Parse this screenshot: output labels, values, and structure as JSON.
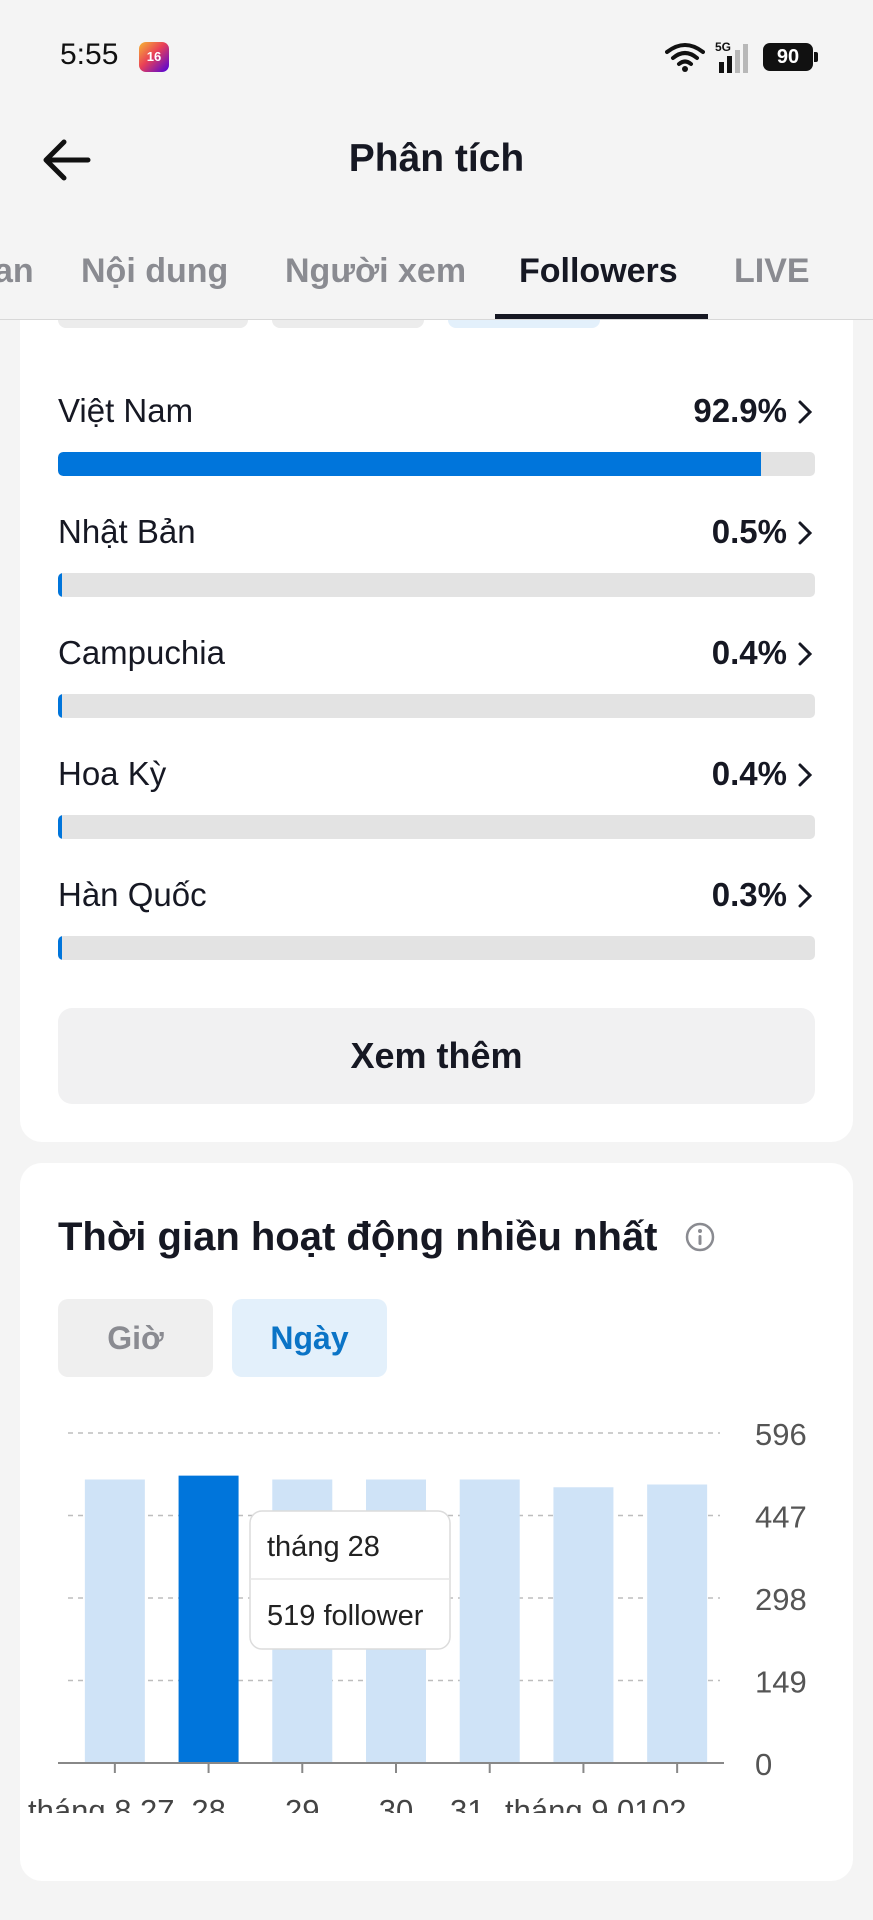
{
  "status_bar": {
    "time": "5:55",
    "app_badge": "16",
    "network": "5G",
    "battery": "90"
  },
  "header": {
    "title": "Phân tích",
    "back_icon": "arrow-left-icon"
  },
  "tabs": [
    {
      "label": "an",
      "active": false
    },
    {
      "label": "Nội dung",
      "active": false
    },
    {
      "label": "Người xem",
      "active": false
    },
    {
      "label": "Followers",
      "active": true
    },
    {
      "label": "LIVE",
      "active": false
    }
  ],
  "countries": [
    {
      "name": "Việt Nam",
      "percent_label": "92.9%",
      "percent": 92.9
    },
    {
      "name": "Nhật Bản",
      "percent_label": "0.5%",
      "percent": 0.5
    },
    {
      "name": "Campuchia",
      "percent_label": "0.4%",
      "percent": 0.4
    },
    {
      "name": "Hoa Kỳ",
      "percent_label": "0.4%",
      "percent": 0.4
    },
    {
      "name": "Hàn Quốc",
      "percent_label": "0.3%",
      "percent": 0.3
    }
  ],
  "see_more_label": "Xem thêm",
  "activity": {
    "title": "Thời gian hoạt động nhiều nhất",
    "toggles": [
      {
        "label": "Giờ",
        "active": false
      },
      {
        "label": "Ngày",
        "active": true
      }
    ],
    "tooltip": {
      "date": "tháng 28",
      "value": "519 follower"
    }
  },
  "colors": {
    "accent": "#0075db",
    "bar_light": "#cfe3f7",
    "track": "#e3e3e3",
    "text": "#161823",
    "muted": "#8a8b91"
  },
  "chart_data": {
    "type": "bar",
    "x_tick_labels": [
      "tháng 8 27",
      "28",
      "29",
      "30",
      "31",
      "tháng 9 01",
      "02"
    ],
    "values": [
      512,
      519,
      512,
      512,
      512,
      498,
      503
    ],
    "highlighted_index": 1,
    "y_ticks": [
      0,
      149,
      298,
      447,
      596
    ],
    "ylim": [
      0,
      596
    ],
    "grid": true,
    "y_axis_side": "right"
  }
}
